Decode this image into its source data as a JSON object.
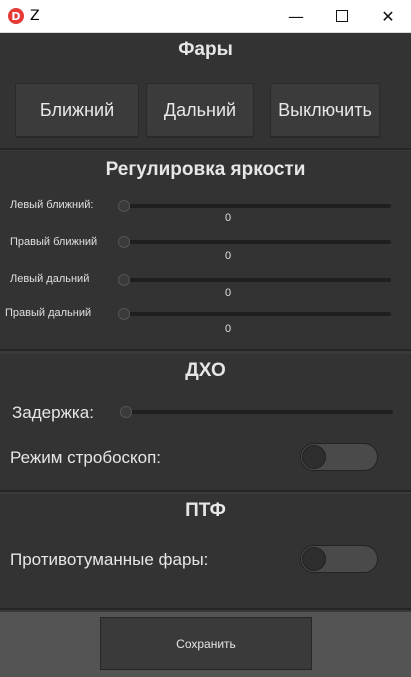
{
  "window": {
    "title": "Z",
    "icon_letter": "D",
    "icons": [
      "minimize-icon",
      "maximize-icon",
      "close-icon"
    ]
  },
  "headlights": {
    "title": "Фары",
    "buttons": {
      "low": "Ближний",
      "high": "Дальний",
      "off": "Выключить"
    }
  },
  "brightness": {
    "title": "Регулировка яркости",
    "sliders": [
      {
        "label": "Левый ближний:",
        "value": "0"
      },
      {
        "label": "Правый ближний",
        "value": "0"
      },
      {
        "label": "Левый дальний",
        "value": "0"
      },
      {
        "label": "Правый дальний",
        "value": "0"
      }
    ]
  },
  "drl": {
    "title": "ДХО",
    "delay_label": "Задержка:",
    "strobe_label": "Режим стробоскоп:",
    "strobe_on": false
  },
  "fog": {
    "title": "ПТФ",
    "fog_label": "Противотуманные фары:",
    "fog_on": false
  },
  "footer": {
    "save_label": "Сохранить"
  }
}
